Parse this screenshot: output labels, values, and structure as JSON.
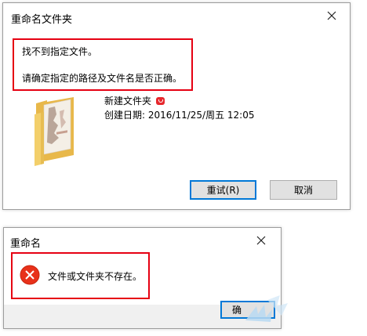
{
  "rename_dialog": {
    "title": "重命名文件夹",
    "message_line1": "找不到指定文件。",
    "message_line2": "请确定指定的路径及文件名是否正确。",
    "folder_name": "新建文件夹",
    "created_label": "创建日期: 2016/11/25/周五 12:05",
    "retry_label": "重试(R)",
    "cancel_label": "取消",
    "close_icon": "close-icon",
    "folder_icon": "folder-icon"
  },
  "error_dialog": {
    "title": "重命名",
    "message": "文件或文件夹不存在。",
    "confirm_label": "确",
    "error_icon": "error-icon"
  },
  "colors": {
    "highlight_border": "#e60012",
    "primary_button_border": "#0078d7",
    "error_icon": "#e8311a",
    "badge": "#e6282d"
  }
}
